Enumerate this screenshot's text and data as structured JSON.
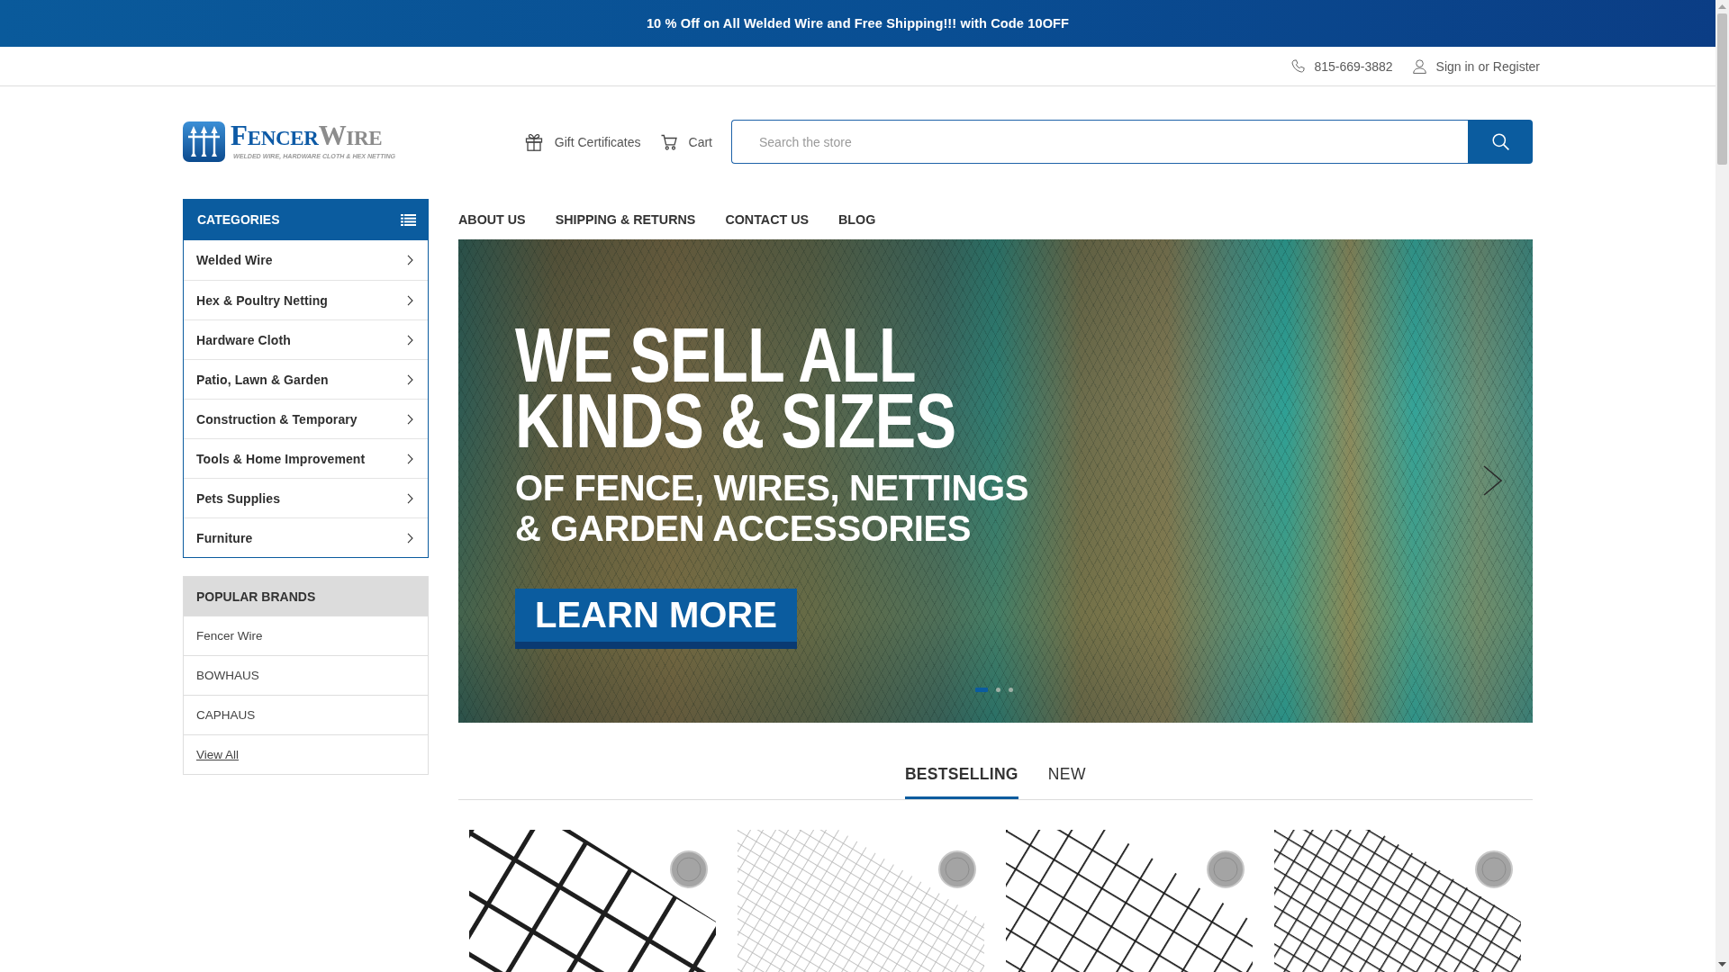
{
  "promo_bar": {
    "text": "10 % Off on All Welded Wire and Free Shipping!!! with Code 10OFF"
  },
  "utility_bar": {
    "phone": "815-669-3882",
    "sign_in": "Sign in",
    "separator": "or",
    "register": "Register"
  },
  "header": {
    "logo": {
      "wordmark": [
        "FENCER",
        "WIRE"
      ],
      "tagline": "WELDED WIRE, HARDWARE CLOTH & HEX NETTING"
    },
    "links": [
      {
        "kind": "gift",
        "label": "Gift Certificates"
      },
      {
        "kind": "cart",
        "label": "Cart"
      }
    ],
    "search": {
      "placeholder": "Search the store"
    }
  },
  "sidebar": {
    "categories": {
      "title": "CATEGORIES",
      "items": [
        "Welded Wire",
        "Hex & Poultry Netting",
        "Hardware Cloth",
        "Patio, Lawn & Garden",
        "Construction & Temporary",
        "Tools & Home Improvement",
        "Pets Supplies",
        "Furniture"
      ]
    },
    "brands": {
      "title": "POPULAR BRANDS",
      "items": [
        {
          "kind": "brand",
          "label": "Fencer Wire"
        },
        {
          "kind": "brand",
          "label": "BOWHAUS"
        },
        {
          "kind": "brand",
          "label": "CAPHAUS"
        },
        {
          "kind": "view_all",
          "label": "View All"
        }
      ]
    }
  },
  "nav": [
    "ABOUT US",
    "SHIPPING & RETURNS",
    "CONTACT US",
    "BLOG"
  ],
  "hero_slide": {
    "headline": [
      "WE SELL ALL",
      "KINDS & SIZES"
    ],
    "subline": [
      "OF FENCE, WIRES, NETTINGS",
      "& GARDEN ACCESSORIES"
    ],
    "button": "LEARN MORE",
    "dots": [
      {
        "selected": true
      },
      {
        "selected": false
      },
      {
        "selected": false
      }
    ]
  },
  "product_tabs": [
    {
      "label": "BESTSELLING",
      "selected": true
    },
    {
      "label": "NEW",
      "selected": false
    }
  ]
}
